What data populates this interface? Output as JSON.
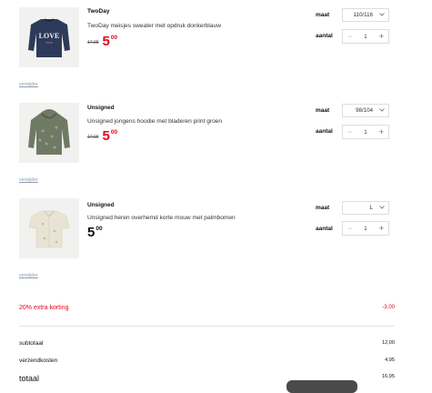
{
  "items": [
    {
      "brand": "TwoDay",
      "title": "TwoDay meisjes sweater met opdruk donkerblauw",
      "old_price": "17,99",
      "price_main": "5",
      "price_cents": "00",
      "size_label": "maat",
      "size_value": "110/116",
      "qty_label": "aantal",
      "qty_value": "1",
      "remove_label": "verwijder",
      "image": "navy-sweater-love-print"
    },
    {
      "brand": "Unsigned",
      "title": "Unsigned jongens hoodie met bladeren print groen",
      "old_price": "17,99",
      "price_main": "5",
      "price_cents": "00",
      "size_label": "maat",
      "size_value": "98/104",
      "qty_label": "aantal",
      "qty_value": "1",
      "remove_label": "verwijder",
      "image": "green-leaf-hoodie"
    },
    {
      "brand": "Unsigned",
      "title": "Unsigned heren overhemd korte mouw met palmbomen",
      "old_price": "",
      "price_main": "5",
      "price_cents": "00",
      "size_label": "maat",
      "size_value": "L",
      "qty_label": "aantal",
      "qty_value": "1",
      "remove_label": "verwijder",
      "image": "cream-palm-shirt"
    }
  ],
  "discount": {
    "label": "20% extra korting",
    "value": "-3,00"
  },
  "summary": {
    "subtotal_label": "subtotaal",
    "subtotal_value": "12,00",
    "shipping_label": "verzendkosten",
    "shipping_value": "4,95",
    "total_label": "totaal",
    "total_value": "16,95"
  },
  "icons": {
    "dropdown": "chevron-down-icon",
    "decrease": "minus-icon",
    "increase": "plus-icon"
  },
  "colors": {
    "accent_red": "#e3051b",
    "link_blue": "#8a9bb0"
  }
}
